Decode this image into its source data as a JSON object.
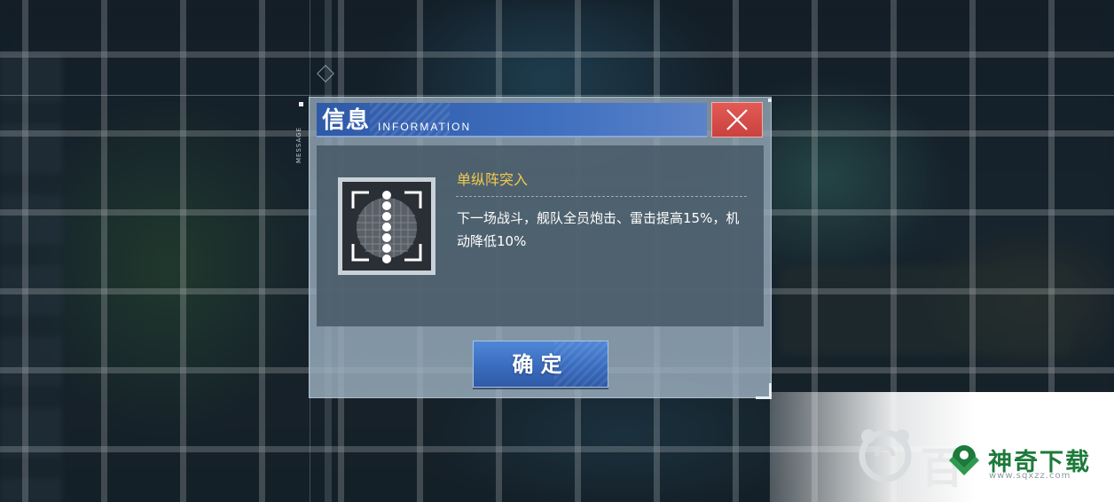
{
  "dialog": {
    "side_label": "MESSAGE",
    "title_cn": "信息",
    "title_en": "INFORMATION",
    "close_icon": "close-x-icon",
    "skill": {
      "icon": "single-column-formation-icon",
      "name": "单纵阵突入",
      "description": "下一场战斗，舰队全员炮击、雷击提高15%，机动降低10%"
    },
    "confirm_label": "确定"
  },
  "watermark": {
    "name": "神奇下载",
    "url": "www.sqxzz.com",
    "ghost_text": "百",
    "logo": "sqxzz-logo-icon"
  },
  "colors": {
    "title_bar": "#3f6fbf",
    "close_button": "#d94d49",
    "skill_name": "#f2c94c",
    "confirm_button": "#3a6cbf",
    "watermark_green": "#1c7a3a"
  }
}
